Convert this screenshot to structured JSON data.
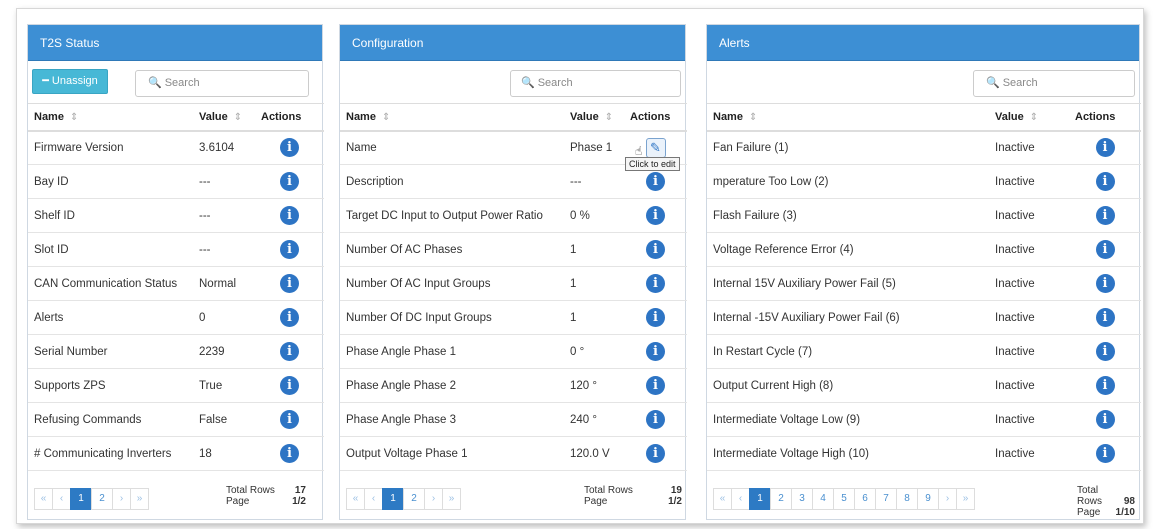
{
  "t2s": {
    "title": "T2S Status",
    "unassign_label": "━ Unassign",
    "search_placeholder": "Search",
    "columns": [
      "Name",
      "Value",
      "Actions"
    ],
    "rows": [
      {
        "name": "Firmware Version",
        "value": "3.6104"
      },
      {
        "name": "Bay ID",
        "value": "---"
      },
      {
        "name": "Shelf ID",
        "value": "---"
      },
      {
        "name": "Slot ID",
        "value": "---"
      },
      {
        "name": "CAN Communication Status",
        "value": "Normal"
      },
      {
        "name": "Alerts",
        "value": "0"
      },
      {
        "name": "Serial Number",
        "value": "2239"
      },
      {
        "name": "Supports ZPS",
        "value": "True"
      },
      {
        "name": "Refusing Commands",
        "value": "False"
      },
      {
        "name": "# Communicating Inverters",
        "value": "18"
      }
    ],
    "pages": [
      "1",
      "2"
    ],
    "total_rows_label": "Total Rows",
    "total_rows": "17",
    "page_label": "Page",
    "page": "1/2"
  },
  "configuration": {
    "title": "Configuration",
    "search_placeholder": "Search",
    "columns": [
      "Name",
      "Value",
      "Actions"
    ],
    "rows": [
      {
        "name": "Name",
        "value": "Phase 1"
      },
      {
        "name": "Description",
        "value": "---"
      },
      {
        "name": "Target DC Input to Output Power Ratio",
        "value": "0 %"
      },
      {
        "name": "Number Of AC Phases",
        "value": "1"
      },
      {
        "name": "Number Of AC Input Groups",
        "value": "1"
      },
      {
        "name": "Number Of DC Input Groups",
        "value": "1"
      },
      {
        "name": "Phase Angle Phase 1",
        "value": "0 °"
      },
      {
        "name": "Phase Angle Phase 2",
        "value": "120 °"
      },
      {
        "name": "Phase Angle Phase 3",
        "value": "240 °"
      },
      {
        "name": "Output Voltage Phase 1",
        "value": "120.0 V"
      }
    ],
    "tooltip": "Click to edit",
    "pages": [
      "1",
      "2"
    ],
    "total_rows_label": "Total Rows",
    "total_rows": "19",
    "page_label": "Page",
    "page": "1/2"
  },
  "alerts": {
    "title": "Alerts",
    "search_placeholder": "Search",
    "columns": [
      "Name",
      "Value",
      "Actions"
    ],
    "rows": [
      {
        "name": "Fan Failure (1)",
        "value": "Inactive"
      },
      {
        "name": "mperature Too Low (2)",
        "value": "Inactive"
      },
      {
        "name": "Flash Failure (3)",
        "value": "Inactive"
      },
      {
        "name": "Voltage Reference Error (4)",
        "value": "Inactive"
      },
      {
        "name": "Internal 15V Auxiliary Power Fail (5)",
        "value": "Inactive"
      },
      {
        "name": "Internal -15V Auxiliary Power Fail (6)",
        "value": "Inactive"
      },
      {
        "name": "In Restart Cycle (7)",
        "value": "Inactive"
      },
      {
        "name": "Output Current High (8)",
        "value": "Inactive"
      },
      {
        "name": "Intermediate Voltage Low (9)",
        "value": "Inactive"
      },
      {
        "name": "Intermediate Voltage High (10)",
        "value": "Inactive"
      }
    ],
    "pages": [
      "1",
      "2",
      "3",
      "4",
      "5",
      "6",
      "7",
      "8",
      "9"
    ],
    "total_rows_label": "Total Rows",
    "total_rows": "98",
    "page_label": "Page",
    "page": "1/10"
  },
  "pager_icons": {
    "first": "«",
    "prev": "‹",
    "next": "›",
    "last": "»"
  },
  "icons": {
    "info": "info-icon",
    "edit": "pencil-edit-icon",
    "search": "search-icon",
    "sort": "sort-icon"
  },
  "colors": {
    "header": "#3d8fd4",
    "info": "#2d74c4",
    "unassign": "#47b8d6",
    "active_page": "#2d7ac4"
  }
}
